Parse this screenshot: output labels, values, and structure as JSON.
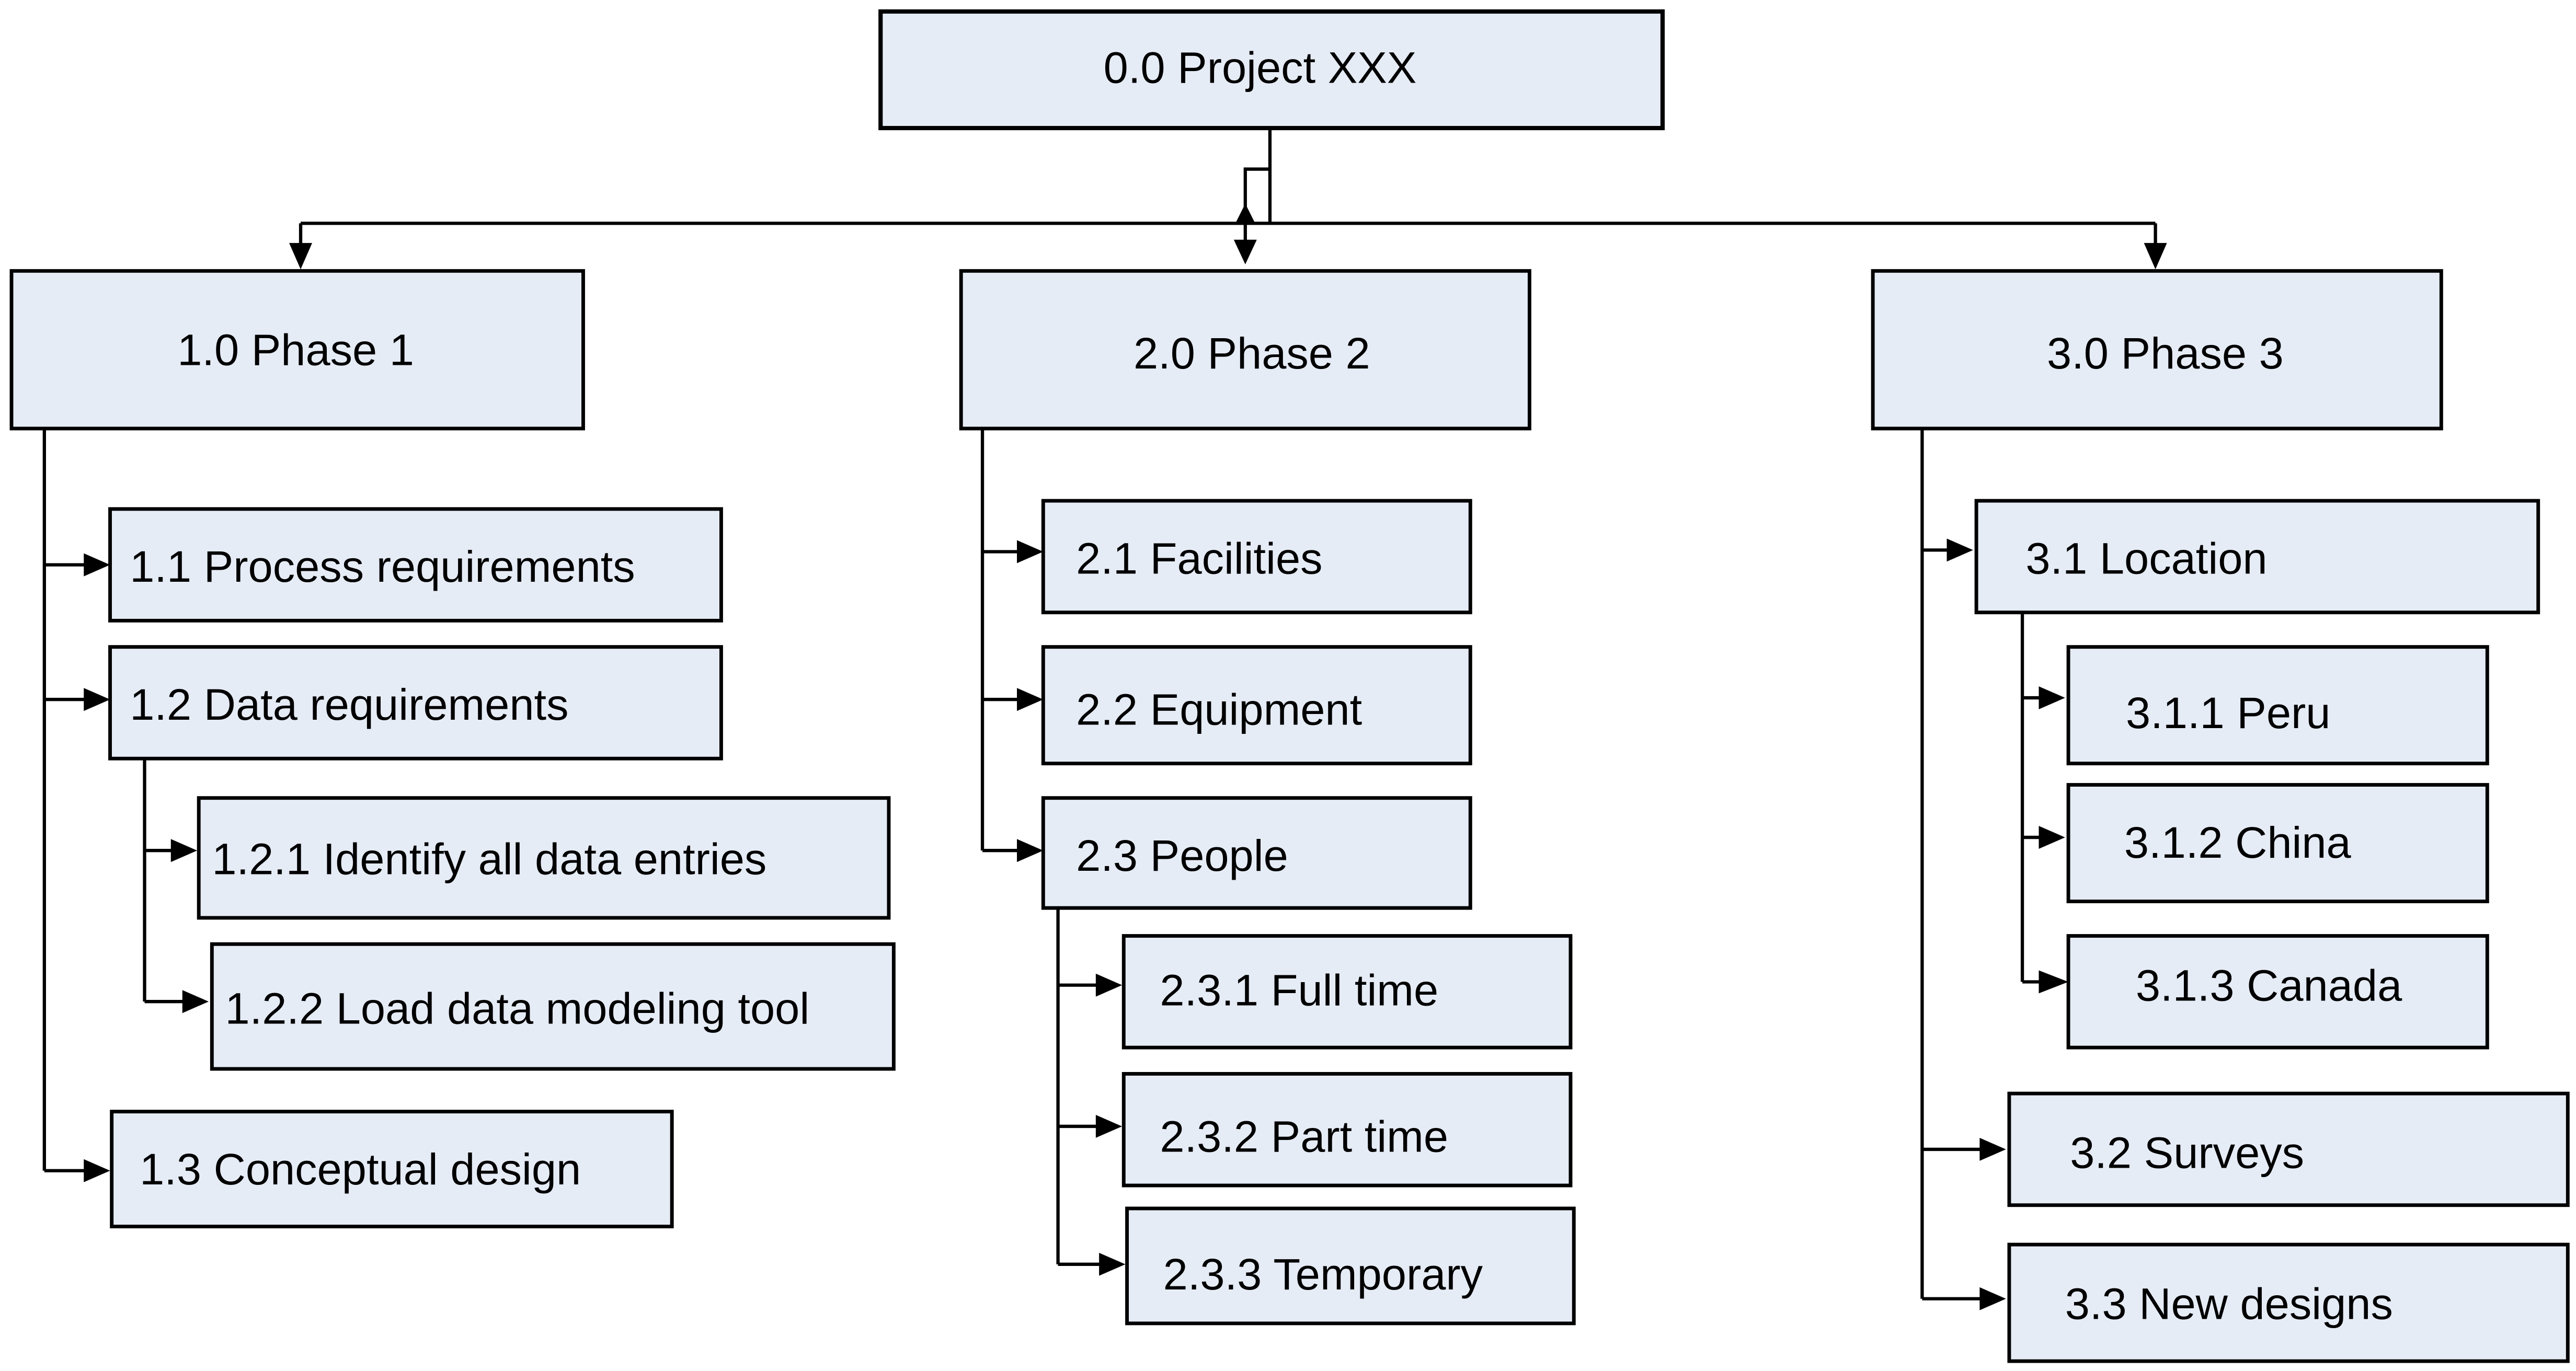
{
  "diagram": {
    "type": "work-breakdown-structure",
    "colors": {
      "box_fill": "#E6ECF6",
      "line": "#000000",
      "text": "#000000"
    },
    "root": {
      "id": "0.0",
      "label": "0.0 Project XXX"
    },
    "phases": [
      {
        "id": "1.0",
        "label": "1.0 Phase 1",
        "children": [
          {
            "id": "1.1",
            "label": "1.1 Process requirements"
          },
          {
            "id": "1.2",
            "label": "1.2 Data requirements",
            "children": [
              {
                "id": "1.2.1",
                "label": "1.2.1 Identify all data entries"
              },
              {
                "id": "1.2.2",
                "label": "1.2.2 Load data modeling tool"
              }
            ]
          },
          {
            "id": "1.3",
            "label": "1.3 Conceptual design"
          }
        ]
      },
      {
        "id": "2.0",
        "label": "2.0 Phase 2",
        "children": [
          {
            "id": "2.1",
            "label": "2.1 Facilities"
          },
          {
            "id": "2.2",
            "label": "2.2 Equipment"
          },
          {
            "id": "2.3",
            "label": "2.3 People",
            "children": [
              {
                "id": "2.3.1",
                "label": "2.3.1 Full time"
              },
              {
                "id": "2.3.2",
                "label": "2.3.2 Part time"
              },
              {
                "id": "2.3.3",
                "label": "2.3.3 Temporary"
              }
            ]
          }
        ]
      },
      {
        "id": "3.0",
        "label": "3.0 Phase 3",
        "children": [
          {
            "id": "3.1",
            "label": "3.1 Location",
            "children": [
              {
                "id": "3.1.1",
                "label": "3.1.1 Peru"
              },
              {
                "id": "3.1.2",
                "label": "3.1.2 China"
              },
              {
                "id": "3.1.3",
                "label": "3.1.3 Canada"
              }
            ]
          },
          {
            "id": "3.2",
            "label": "3.2 Surveys"
          },
          {
            "id": "3.3",
            "label": "3.3 New designs"
          }
        ]
      }
    ]
  }
}
